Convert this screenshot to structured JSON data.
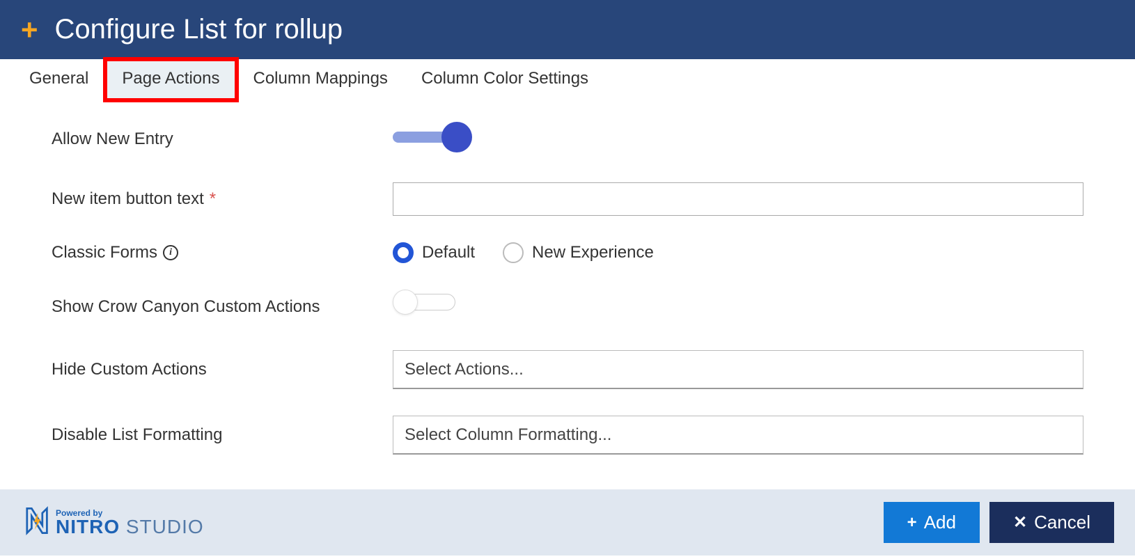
{
  "header": {
    "title": "Configure List for rollup"
  },
  "tabs": [
    {
      "label": "General",
      "active": false
    },
    {
      "label": "Page Actions",
      "active": true,
      "highlighted": true
    },
    {
      "label": "Column Mappings",
      "active": false
    },
    {
      "label": "Column Color Settings",
      "active": false
    }
  ],
  "form": {
    "allow_new_entry": {
      "label": "Allow New Entry",
      "value": true
    },
    "new_item_button_text": {
      "label": "New item button text",
      "required": true,
      "value": ""
    },
    "classic_forms": {
      "label": "Classic Forms",
      "options": [
        {
          "label": "Default",
          "selected": true
        },
        {
          "label": "New Experience",
          "selected": false
        }
      ]
    },
    "show_custom_actions": {
      "label": "Show Crow Canyon Custom Actions",
      "value": false
    },
    "hide_custom_actions": {
      "label": "Hide Custom Actions",
      "placeholder": "Select Actions..."
    },
    "disable_list_formatting": {
      "label": "Disable List Formatting",
      "placeholder": "Select Column Formatting..."
    }
  },
  "footer": {
    "logo": {
      "powered_by": "Powered by",
      "brand": "NITRO",
      "studio": " STUDIO"
    },
    "add_button": "Add",
    "cancel_button": "Cancel"
  }
}
